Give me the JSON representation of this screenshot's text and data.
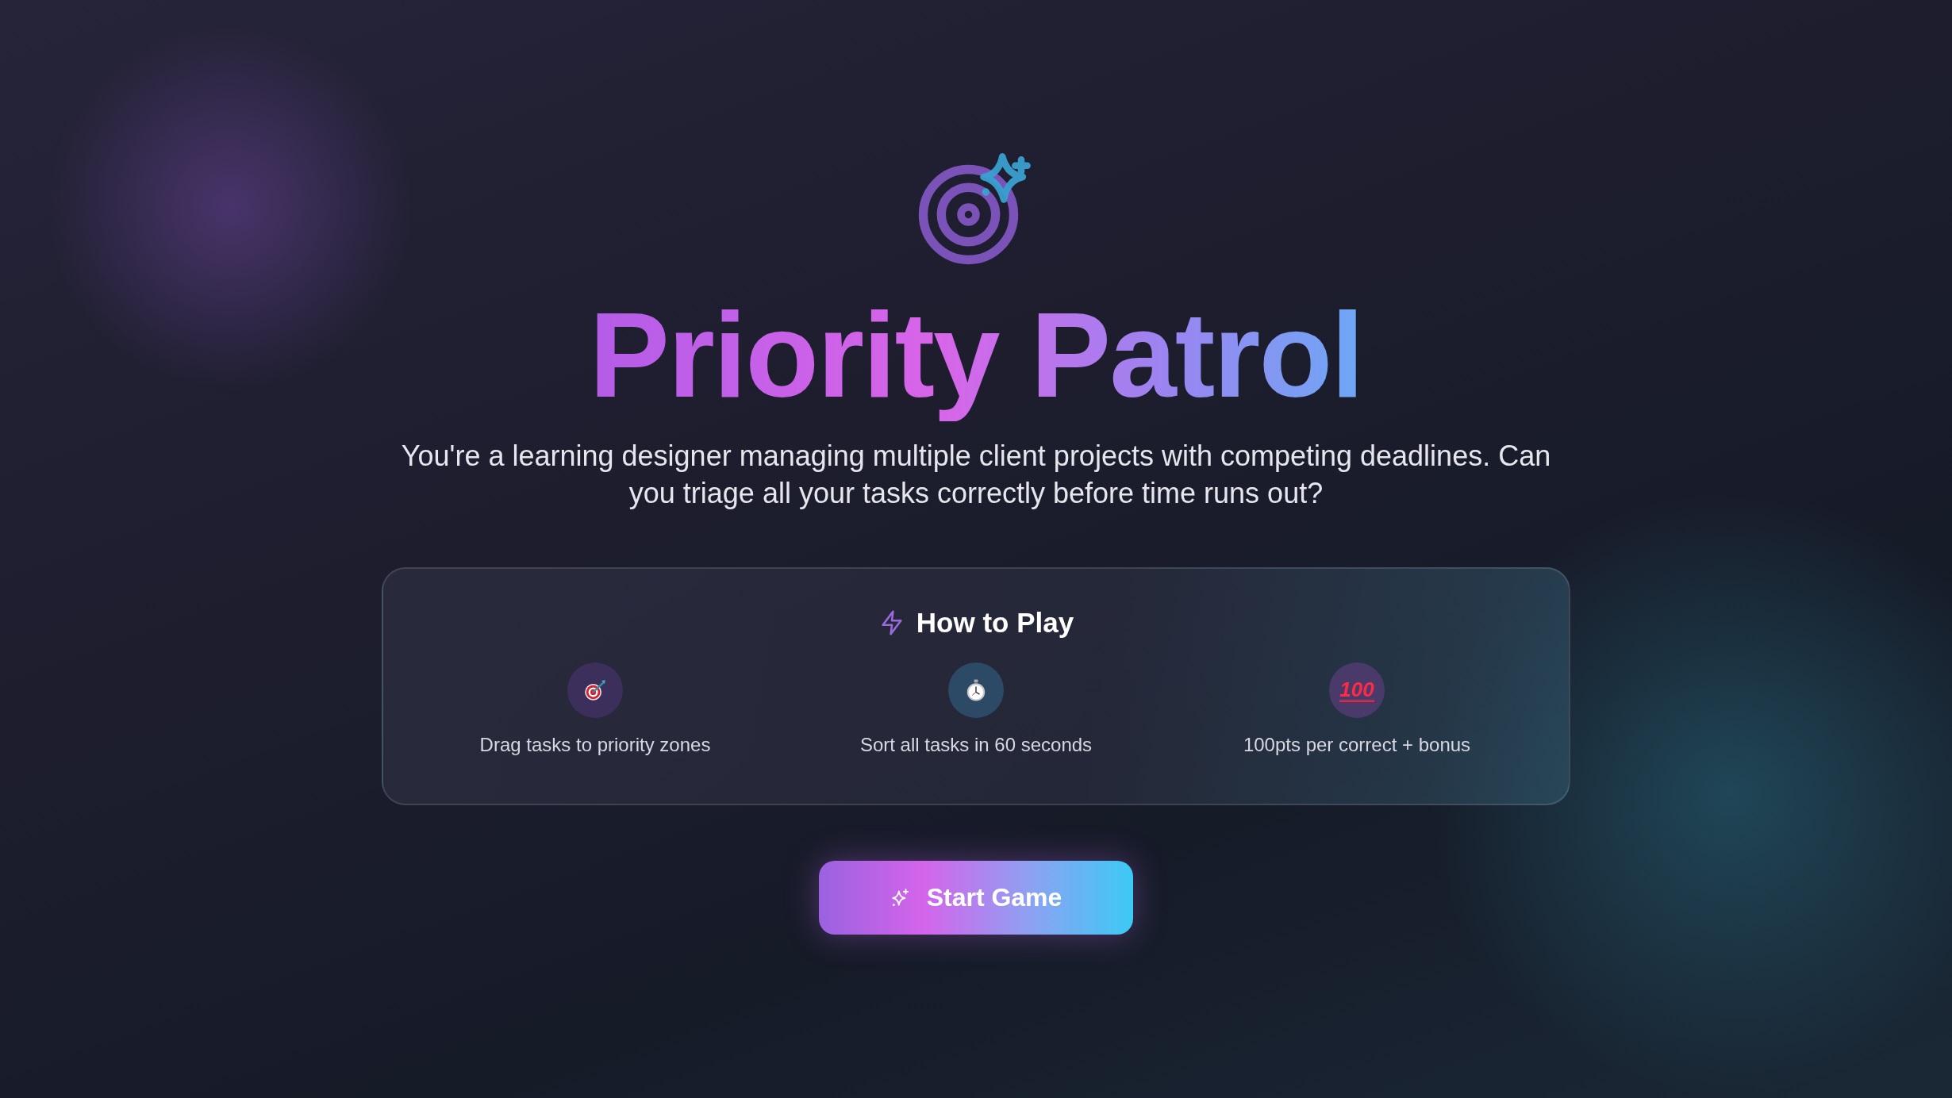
{
  "title": "Priority Patrol",
  "subtitle": "You're a learning designer managing multiple client projects with competing deadlines. Can you triage all your tasks correctly before time runs out?",
  "how_to_play": {
    "heading": "How to Play",
    "features": [
      {
        "kind": "target",
        "label": "Drag tasks to priority zones"
      },
      {
        "kind": "stopwatch",
        "label": "Sort all tasks in 60 seconds"
      },
      {
        "kind": "hundred",
        "icon_text": "100",
        "label": "100pts per correct + bonus"
      }
    ]
  },
  "start_button": "Start Game"
}
